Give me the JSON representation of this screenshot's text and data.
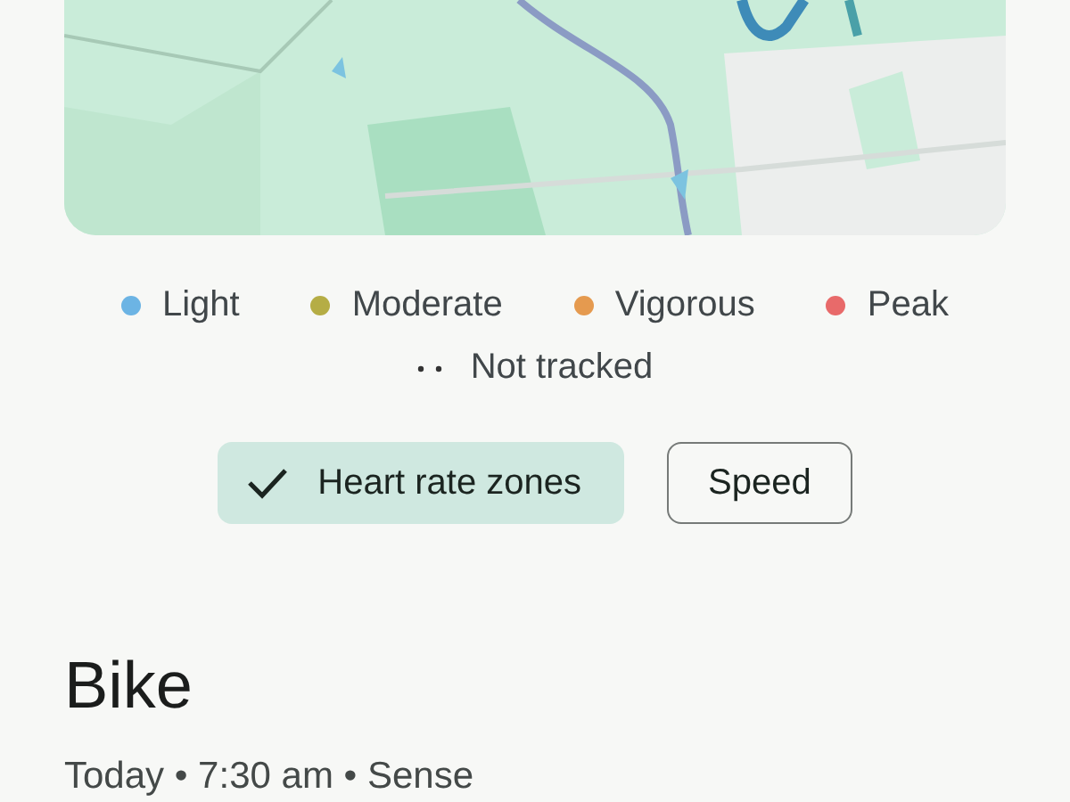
{
  "legend": [
    {
      "label": "Light",
      "color": "#6cb4e4"
    },
    {
      "label": "Moderate",
      "color": "#b5ad45"
    },
    {
      "label": "Vigorous",
      "color": "#e59a4f"
    },
    {
      "label": "Peak",
      "color": "#e86a6a"
    }
  ],
  "not_tracked": {
    "label": "Not tracked"
  },
  "chips": [
    {
      "label": "Heart rate zones",
      "selected": true
    },
    {
      "label": "Speed",
      "selected": false
    }
  ],
  "activity": {
    "title": "Bike",
    "subtitle": "Today • 7:30 am • Sense"
  }
}
